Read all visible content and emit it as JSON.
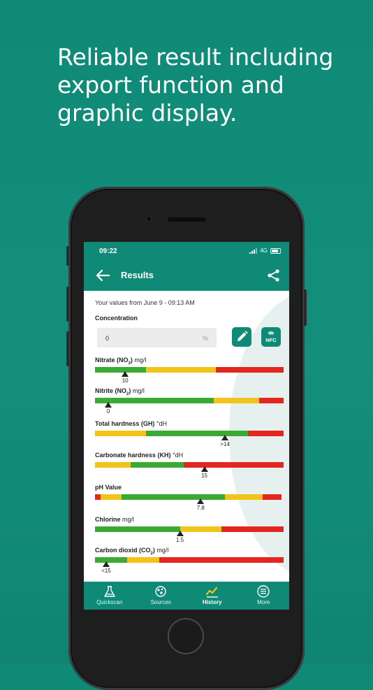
{
  "headline": {
    "line1": "Reliable result including",
    "line2": "export function and",
    "line3": "graphic display."
  },
  "status_bar": {
    "time": "09:22",
    "network": "4G"
  },
  "app_bar": {
    "title": "Results"
  },
  "results": {
    "date_text": "Your values from June 9 - 09:13 AM",
    "concentration_label": "Concentration",
    "concentration_value": "0",
    "concentration_unit": "%",
    "nfc_label": "NFC"
  },
  "colors": {
    "brand": "#0e8a76",
    "green": "#3aaa35",
    "yellow": "#f2c318",
    "red": "#e3261f"
  },
  "parameters": [
    {
      "name": "Nitrate (NO",
      "sub": "3",
      "close": ")",
      "unit": "mg/l",
      "value": "10",
      "marker_frac": 0.16,
      "segments": [
        {
          "color": "green",
          "frac": 0.27
        },
        {
          "color": "yellow",
          "frac": 0.37
        },
        {
          "color": "red",
          "frac": 0.36
        }
      ]
    },
    {
      "name": "Nitrite (NO",
      "sub": "2",
      "close": ")",
      "unit": "mg/l",
      "value": "0",
      "marker_frac": 0.07,
      "segments": [
        {
          "color": "green",
          "frac": 0.63
        },
        {
          "color": "yellow",
          "frac": 0.24
        },
        {
          "color": "red",
          "frac": 0.13
        }
      ]
    },
    {
      "name": "Total hardness (GH)",
      "sub": "",
      "close": "",
      "unit": "°dH",
      "value": ">14",
      "marker_frac": 0.69,
      "segments": [
        {
          "color": "yellow",
          "frac": 0.27
        },
        {
          "color": "green",
          "frac": 0.54
        },
        {
          "color": "red",
          "frac": 0.19
        }
      ]
    },
    {
      "name": "Carbonate hardness (KH)",
      "sub": "",
      "close": "",
      "unit": "°dH",
      "value": "15",
      "marker_frac": 0.58,
      "segments": [
        {
          "color": "yellow",
          "frac": 0.19
        },
        {
          "color": "green",
          "frac": 0.28
        },
        {
          "color": "red",
          "frac": 0.53
        }
      ]
    },
    {
      "name": "pH Value",
      "sub": "",
      "close": "",
      "unit": "",
      "value": "7.8",
      "marker_frac": 0.56,
      "segments": [
        {
          "color": "red",
          "frac": 0.03
        },
        {
          "color": "yellow",
          "frac": 0.11
        },
        {
          "color": "green",
          "frac": 0.55
        },
        {
          "color": "yellow",
          "frac": 0.2
        },
        {
          "color": "red",
          "frac": 0.1
        },
        {
          "color": "white",
          "frac": 0.01
        }
      ]
    },
    {
      "name": "Chlorine",
      "sub": "",
      "close": "",
      "unit": "mg/l",
      "value": "1.5",
      "marker_frac": 0.45,
      "segments": [
        {
          "color": "green",
          "frac": 0.45
        },
        {
          "color": "yellow",
          "frac": 0.22
        },
        {
          "color": "red",
          "frac": 0.33
        }
      ]
    },
    {
      "name": "Carbon dioxid (CO",
      "sub": "2",
      "close": ")",
      "unit": "mg/l",
      "value": "<15",
      "marker_frac": 0.06,
      "segments": [
        {
          "color": "green",
          "frac": 0.17
        },
        {
          "color": "yellow",
          "frac": 0.17
        },
        {
          "color": "red",
          "frac": 0.66
        }
      ]
    }
  ],
  "tabs": [
    {
      "label": "Quickscan",
      "icon": "flask-icon",
      "active": false
    },
    {
      "label": "Sources",
      "icon": "sources-icon",
      "active": false
    },
    {
      "label": "History",
      "icon": "history-chart-icon",
      "active": true
    },
    {
      "label": "More",
      "icon": "menu-icon",
      "active": false
    }
  ]
}
